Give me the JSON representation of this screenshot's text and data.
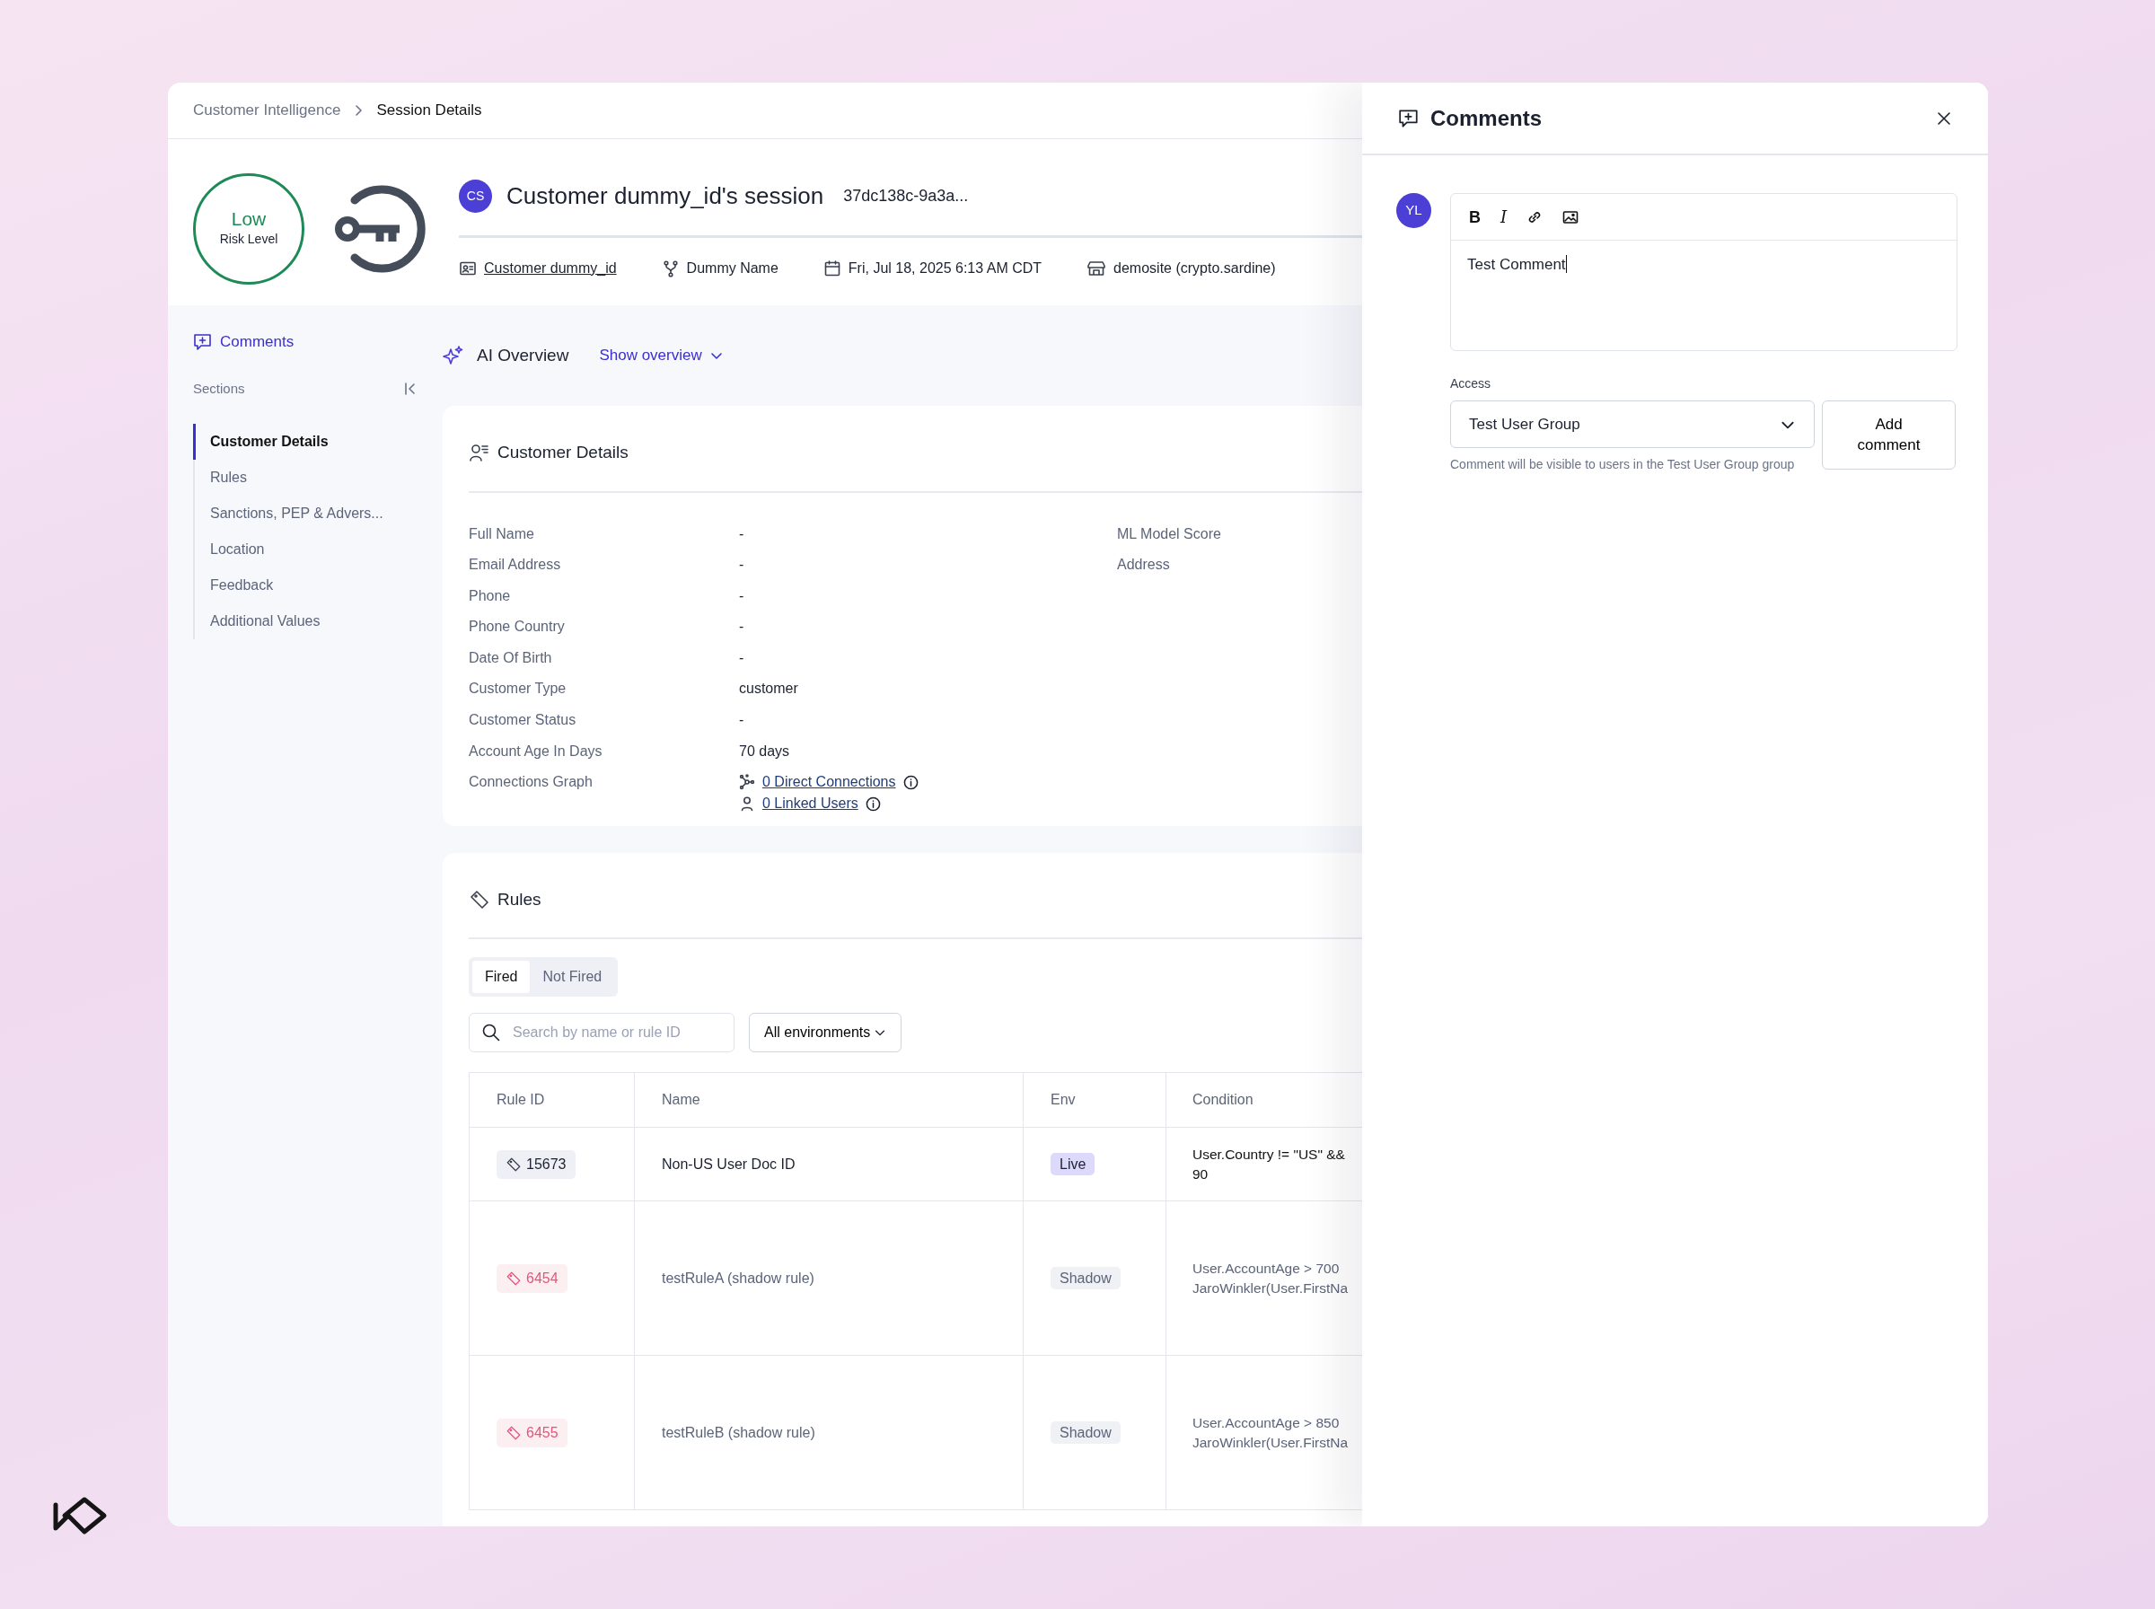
{
  "breadcrumb": [
    {
      "label": "Customer Intelligence",
      "current": false
    },
    {
      "label": "Session Details",
      "current": true
    }
  ],
  "risk": {
    "level": "Low",
    "label": "Risk Level"
  },
  "session": {
    "avatar": "CS",
    "title": "Customer dummy_id's session",
    "id": "37dc138c-9a3a...",
    "meta": [
      {
        "kind": "user",
        "text": "Customer dummy_id",
        "link": true
      },
      {
        "kind": "fork",
        "text": "Dummy Name",
        "link": false
      },
      {
        "kind": "calendar",
        "text": "Fri, Jul 18, 2025 6:13 AM CDT",
        "link": false
      },
      {
        "kind": "store",
        "text": "demosite (crypto.sardine)",
        "link": false
      }
    ]
  },
  "sidebar": {
    "comments_link": "Comments",
    "sections_label": "Sections",
    "items": [
      {
        "label": "Customer Details",
        "selected": true
      },
      {
        "label": "Rules",
        "selected": false
      },
      {
        "label": "Sanctions, PEP & Advers...",
        "selected": false
      },
      {
        "label": "Location",
        "selected": false
      },
      {
        "label": "Feedback",
        "selected": false
      },
      {
        "label": "Additional Values",
        "selected": false
      }
    ]
  },
  "ai_overview": {
    "title": "AI Overview",
    "toggle": "Show overview"
  },
  "customer_details": {
    "title": "Customer Details",
    "fields": [
      {
        "label": "Full Name",
        "value": "-"
      },
      {
        "label": "Email Address",
        "value": "-"
      },
      {
        "label": "Phone",
        "value": "-"
      },
      {
        "label": "Phone Country",
        "value": "-"
      },
      {
        "label": "Date Of Birth",
        "value": "-"
      },
      {
        "label": "Customer Type",
        "value": "customer"
      },
      {
        "label": "Customer Status",
        "value": "-"
      },
      {
        "label": "Account Age In Days",
        "value": "70 days"
      },
      {
        "label": "Connections Graph",
        "links": [
          {
            "kind": "graph",
            "text": "0 Direct Connections"
          },
          {
            "kind": "person",
            "text": "0 Linked Users"
          }
        ]
      }
    ],
    "right_fields": [
      {
        "label": "ML Model Score"
      },
      {
        "label": "Address"
      }
    ]
  },
  "rules": {
    "title": "Rules",
    "tabs": [
      {
        "label": "Fired",
        "selected": true
      },
      {
        "label": "Not Fired",
        "selected": false
      }
    ],
    "search": {
      "placeholder": "Search by name or rule ID"
    },
    "env_filter": "All environments",
    "columns": [
      "Rule ID",
      "Name",
      "Env",
      "Condition"
    ],
    "rows": [
      {
        "kind": "live",
        "id": "15673",
        "name": "Non-US User Doc ID",
        "env": "Live",
        "condition": [
          "User.Country != \"US\" &&",
          "90"
        ]
      },
      {
        "kind": "shadow",
        "id": "6454",
        "name": "testRuleA (shadow rule)",
        "env": "Shadow",
        "condition": [
          "User.AccountAge > 700",
          "JaroWinkler(User.FirstNa"
        ]
      },
      {
        "kind": "shadow",
        "id": "6455",
        "name": "testRuleB (shadow rule)",
        "env": "Shadow",
        "condition": [
          "User.AccountAge > 850",
          "JaroWinkler(User.FirstNa"
        ]
      }
    ]
  },
  "comments": {
    "title": "Comments",
    "avatar": "YL",
    "toolbar": [
      {
        "kind": "bold",
        "glyph": "B"
      },
      {
        "kind": "italic",
        "glyph": "I"
      },
      {
        "kind": "link"
      },
      {
        "kind": "image"
      }
    ],
    "text": "Test Comment",
    "access_label": "Access",
    "access_value": "Test User Group",
    "hint": "Comment will be visible to users in the Test User Group group",
    "submit": "Add comment"
  }
}
